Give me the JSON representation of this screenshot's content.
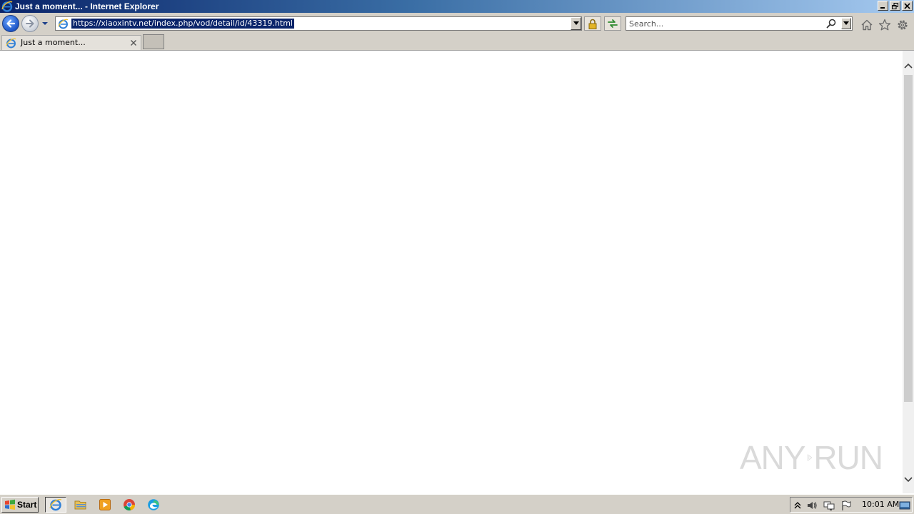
{
  "window": {
    "title": "Just a moment... - Internet Explorer"
  },
  "address_bar": {
    "url": "https://xiaoxintv.net/index.php/vod/detail/id/43319.html"
  },
  "search": {
    "placeholder": "Search..."
  },
  "tabs": [
    {
      "label": "Just a moment..."
    }
  ],
  "watermark": {
    "text_left": "ANY",
    "text_right": "RUN"
  },
  "taskbar": {
    "start_label": "Start",
    "clock": "10:01 AM"
  },
  "icons": {
    "app": "ie-icon",
    "back": "back-arrow-icon",
    "forward": "forward-arrow-icon",
    "lock": "lock-icon",
    "refresh": "refresh-icon",
    "search": "magnifier-icon",
    "home": "home-icon",
    "favorites": "star-icon",
    "tools": "gear-icon"
  },
  "colors": {
    "title_bar_start": "#0a246a",
    "title_bar_end": "#a6caf0",
    "chrome": "#d4d0c8",
    "url_highlight": "#0a246a"
  }
}
